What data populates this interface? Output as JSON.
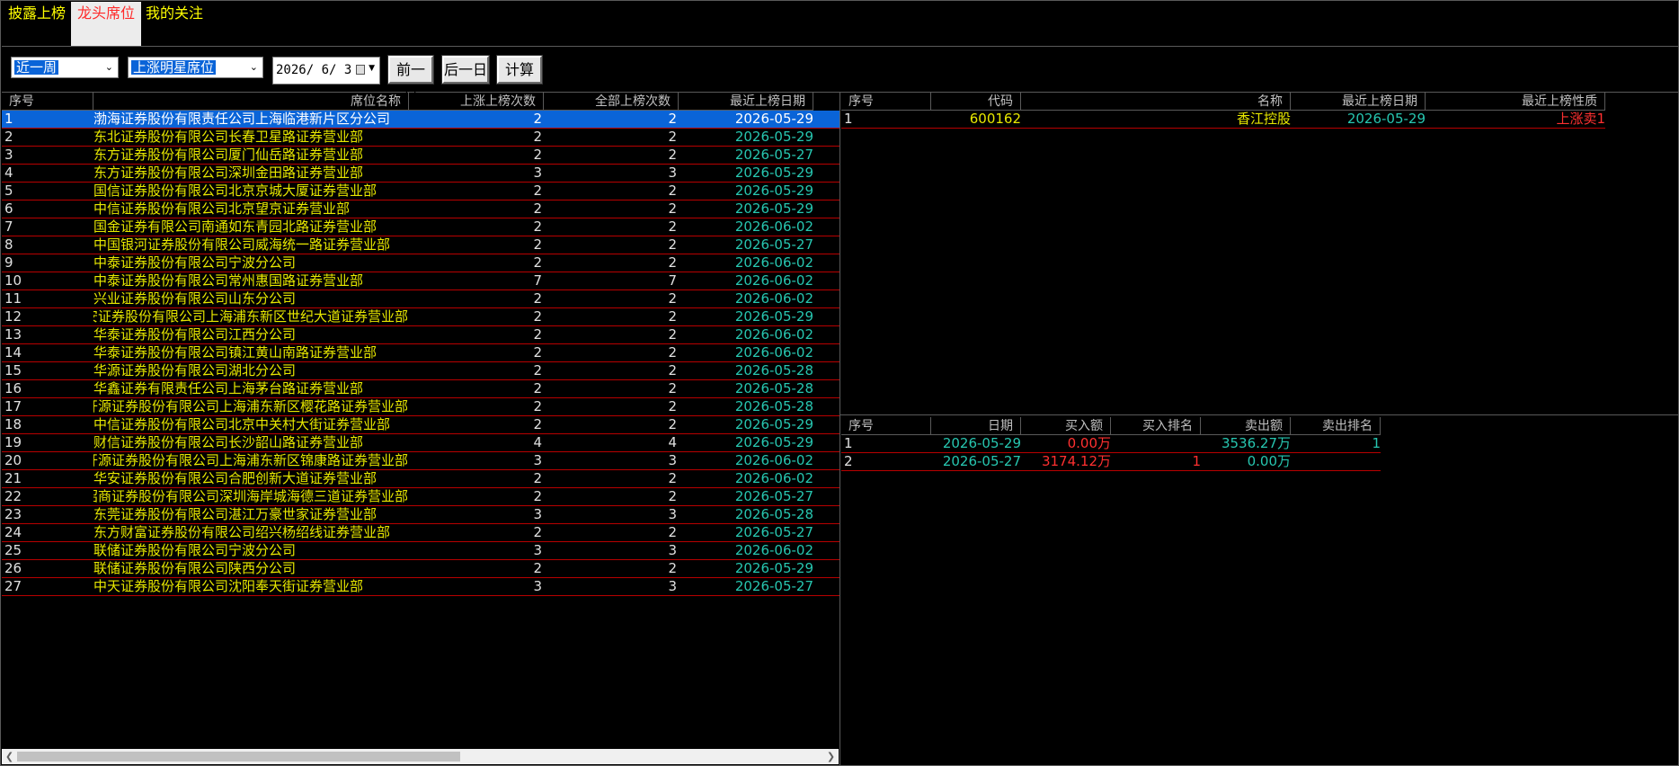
{
  "tabs": [
    {
      "label": "披露上榜",
      "active": false
    },
    {
      "label": "龙头席位",
      "active": true
    },
    {
      "label": "我的关注",
      "active": false
    }
  ],
  "toolbar": {
    "period": "近一周",
    "seat_type": "上涨明星席位",
    "date": "2026/ 6/ 3",
    "prev_day": "前一日",
    "next_day": "后一日",
    "calc": "计算"
  },
  "left_table": {
    "headers": [
      "序号",
      "席位名称",
      "上涨上榜次数",
      "全部上榜次数",
      "最近上榜日期"
    ],
    "rows": [
      {
        "no": "1",
        "name": "渤海证券股份有限责任公司上海临港新片区分公司",
        "up": "2",
        "all": "2",
        "date": "2026-05-29"
      },
      {
        "no": "2",
        "name": "东北证券股份有限公司长春卫星路证券营业部",
        "up": "2",
        "all": "2",
        "date": "2026-05-29"
      },
      {
        "no": "3",
        "name": "东方证券股份有限公司厦门仙岳路证券营业部",
        "up": "2",
        "all": "2",
        "date": "2026-05-27"
      },
      {
        "no": "4",
        "name": "东方证券股份有限公司深圳金田路证券营业部",
        "up": "3",
        "all": "3",
        "date": "2026-05-29"
      },
      {
        "no": "5",
        "name": "国信证券股份有限公司北京京城大厦证券营业部",
        "up": "2",
        "all": "2",
        "date": "2026-05-29"
      },
      {
        "no": "6",
        "name": "中信证券股份有限公司北京望京证券营业部",
        "up": "2",
        "all": "2",
        "date": "2026-05-29"
      },
      {
        "no": "7",
        "name": "国金证券有限公司南通如东青园北路证券营业部",
        "up": "2",
        "all": "2",
        "date": "2026-06-02"
      },
      {
        "no": "8",
        "name": "中国银河证券股份有限公司威海统一路证券营业部",
        "up": "2",
        "all": "2",
        "date": "2026-05-27"
      },
      {
        "no": "9",
        "name": "中泰证券股份有限公司宁波分公司",
        "up": "2",
        "all": "2",
        "date": "2026-06-02"
      },
      {
        "no": "10",
        "name": "中泰证券股份有限公司常州惠国路证券营业部",
        "up": "7",
        "all": "7",
        "date": "2026-06-02"
      },
      {
        "no": "11",
        "name": "兴业证券股份有限公司山东分公司",
        "up": "2",
        "all": "2",
        "date": "2026-06-02"
      },
      {
        "no": "12",
        "name": "国泰君安证券股份有限公司上海浦东新区世纪大道证券营业部",
        "up": "2",
        "all": "2",
        "date": "2026-05-29"
      },
      {
        "no": "13",
        "name": "华泰证券股份有限公司江西分公司",
        "up": "2",
        "all": "2",
        "date": "2026-06-02"
      },
      {
        "no": "14",
        "name": "华泰证券股份有限公司镇江黄山南路证券营业部",
        "up": "2",
        "all": "2",
        "date": "2026-06-02"
      },
      {
        "no": "15",
        "name": "华源证券股份有限公司湖北分公司",
        "up": "2",
        "all": "2",
        "date": "2026-05-28"
      },
      {
        "no": "16",
        "name": "华鑫证券有限责任公司上海茅台路证券营业部",
        "up": "2",
        "all": "2",
        "date": "2026-05-28"
      },
      {
        "no": "17",
        "name": "开源证券股份有限公司上海浦东新区樱花路证券营业部",
        "up": "2",
        "all": "2",
        "date": "2026-05-28"
      },
      {
        "no": "18",
        "name": "中信证券股份有限公司北京中关村大街证券营业部",
        "up": "2",
        "all": "2",
        "date": "2026-05-29"
      },
      {
        "no": "19",
        "name": "财信证券股份有限公司长沙韶山路证券营业部",
        "up": "4",
        "all": "4",
        "date": "2026-05-29"
      },
      {
        "no": "20",
        "name": "开源证券股份有限公司上海浦东新区锦康路证券营业部",
        "up": "3",
        "all": "3",
        "date": "2026-06-02"
      },
      {
        "no": "21",
        "name": "华安证券股份有限公司合肥创新大道证券营业部",
        "up": "2",
        "all": "2",
        "date": "2026-06-02"
      },
      {
        "no": "22",
        "name": "招商证券股份有限公司深圳海岸城海德三道证券营业部",
        "up": "2",
        "all": "2",
        "date": "2026-05-27"
      },
      {
        "no": "23",
        "name": "东莞证券股份有限公司湛江万豪世家证券营业部",
        "up": "3",
        "all": "3",
        "date": "2026-05-28"
      },
      {
        "no": "24",
        "name": "东方财富证券股份有限公司绍兴杨绍线证券营业部",
        "up": "2",
        "all": "2",
        "date": "2026-05-27"
      },
      {
        "no": "25",
        "name": "联储证券股份有限公司宁波分公司",
        "up": "3",
        "all": "3",
        "date": "2026-06-02"
      },
      {
        "no": "26",
        "name": "联储证券股份有限公司陕西分公司",
        "up": "2",
        "all": "2",
        "date": "2026-05-29"
      },
      {
        "no": "27",
        "name": "中天证券股份有限公司沈阳奉天街证券营业部",
        "up": "3",
        "all": "3",
        "date": "2026-05-27"
      }
    ]
  },
  "right_top_table": {
    "headers": [
      "序号",
      "代码",
      "名称",
      "最近上榜日期",
      "最近上榜性质"
    ],
    "rows": [
      {
        "no": "1",
        "code": "600162",
        "name": "香江控股",
        "date": "2026-05-29",
        "nature": "上涨卖1"
      }
    ]
  },
  "right_bottom_table": {
    "headers": [
      "序号",
      "日期",
      "买入额",
      "买入排名",
      "卖出额",
      "卖出排名"
    ],
    "rows": [
      {
        "no": "1",
        "date": "2026-05-29",
        "buy": "0.00万",
        "buy_rank": "",
        "sell": "3536.27万",
        "sell_rank": "1"
      },
      {
        "no": "2",
        "date": "2026-05-27",
        "buy": "3174.12万",
        "buy_rank": "1",
        "sell": "0.00万",
        "sell_rank": ""
      }
    ]
  },
  "colors": {
    "selection": "#0a64d8",
    "row_border": "#b80000",
    "yellow": "#e8e800",
    "teal": "#27c6b0",
    "red": "#ff3030"
  }
}
